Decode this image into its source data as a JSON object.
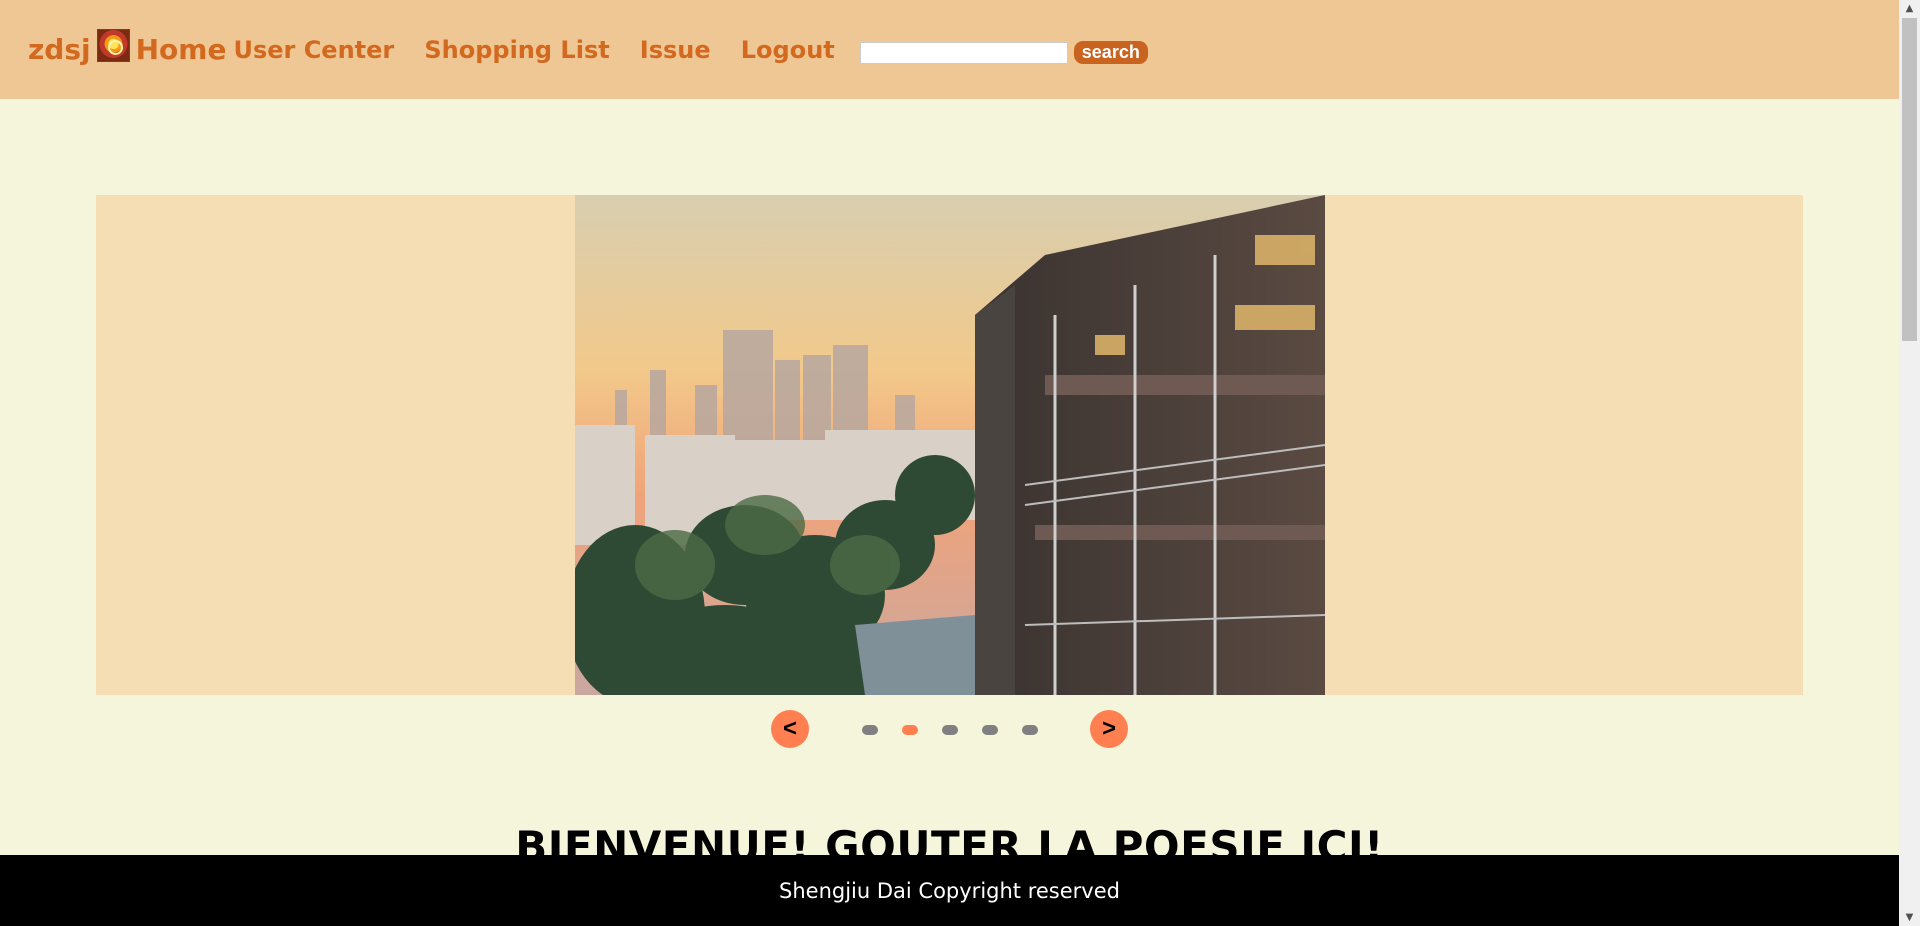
{
  "header": {
    "brand_text": "zdsj",
    "home_label": "Home",
    "nav": [
      {
        "label": "User Center"
      },
      {
        "label": "Shopping List"
      },
      {
        "label": "Issue"
      },
      {
        "label": "Logout"
      }
    ],
    "search": {
      "value": "",
      "placeholder": "",
      "button_label": "search"
    }
  },
  "carousel": {
    "prev_label": "<",
    "next_label": ">",
    "dot_count": 5,
    "active_index": 1,
    "image_icon": "sunset-campus-photo"
  },
  "welcome_heading": "BIENVENUE! GOUTER LA POESIE ICI!",
  "footer": {
    "text": "Shengjiu Dai Copyright reserved"
  },
  "colors": {
    "header_bg": "#eec795",
    "page_bg": "#f5f5dc",
    "accent": "#d2691e",
    "carousel_bg": "#f5deb3",
    "carousel_button": "#ff7f50",
    "footer_bg": "#000000"
  }
}
